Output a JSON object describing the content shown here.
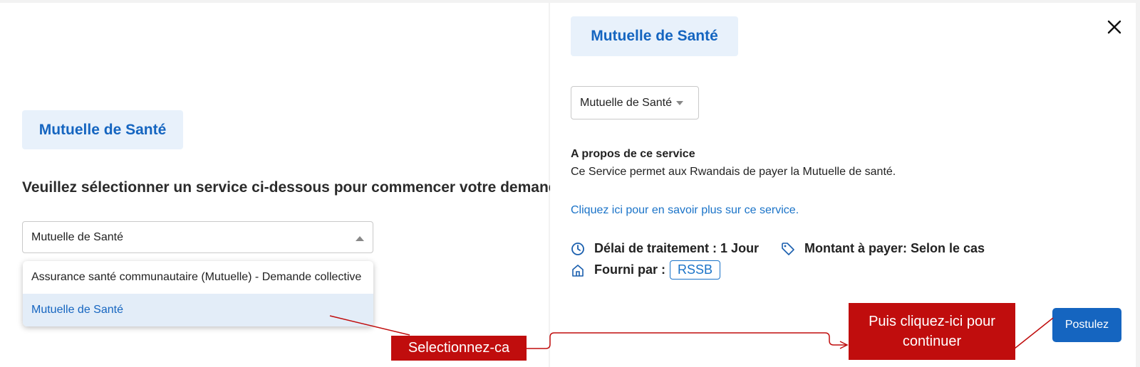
{
  "left_panel": {
    "chip_label": "Mutuelle de Santé",
    "heading": "Veuillez sélectionner un service ci-dessous pour commencer votre demande",
    "select_value": "Mutuelle de Santé",
    "dropdown_options": [
      "Assurance santé communautaire (Mutuelle) - Demande collective",
      "Mutuelle de Santé"
    ]
  },
  "right_panel": {
    "chip_label": "Mutuelle de Santé",
    "select_value": "Mutuelle de Santé",
    "about_title": "A propos de ce service",
    "about_desc": "Ce Service permet aux Rwandais de payer la Mutuelle de santé.",
    "learn_more_link": "Cliquez ici pour en savoir plus sur ce service.",
    "processing_label": "Délai de traitement : 1 Jour",
    "amount_label": "Montant à payer: Selon le cas",
    "provider_label": "Fourni par :",
    "provider_badge": "RSSB",
    "apply_button": "Postulez"
  },
  "annotations": {
    "select_hint": "Selectionnez-ca",
    "continue_hint": "Puis cliquez-ici pour continuer"
  },
  "colors": {
    "accent": "#1565c0",
    "chip_bg": "#e8f1fb",
    "annotation_red": "#c00d0d"
  },
  "icons": [
    "clock-icon",
    "tag-icon",
    "home-icon",
    "close-icon",
    "caret-up-icon",
    "caret-down-icon"
  ]
}
